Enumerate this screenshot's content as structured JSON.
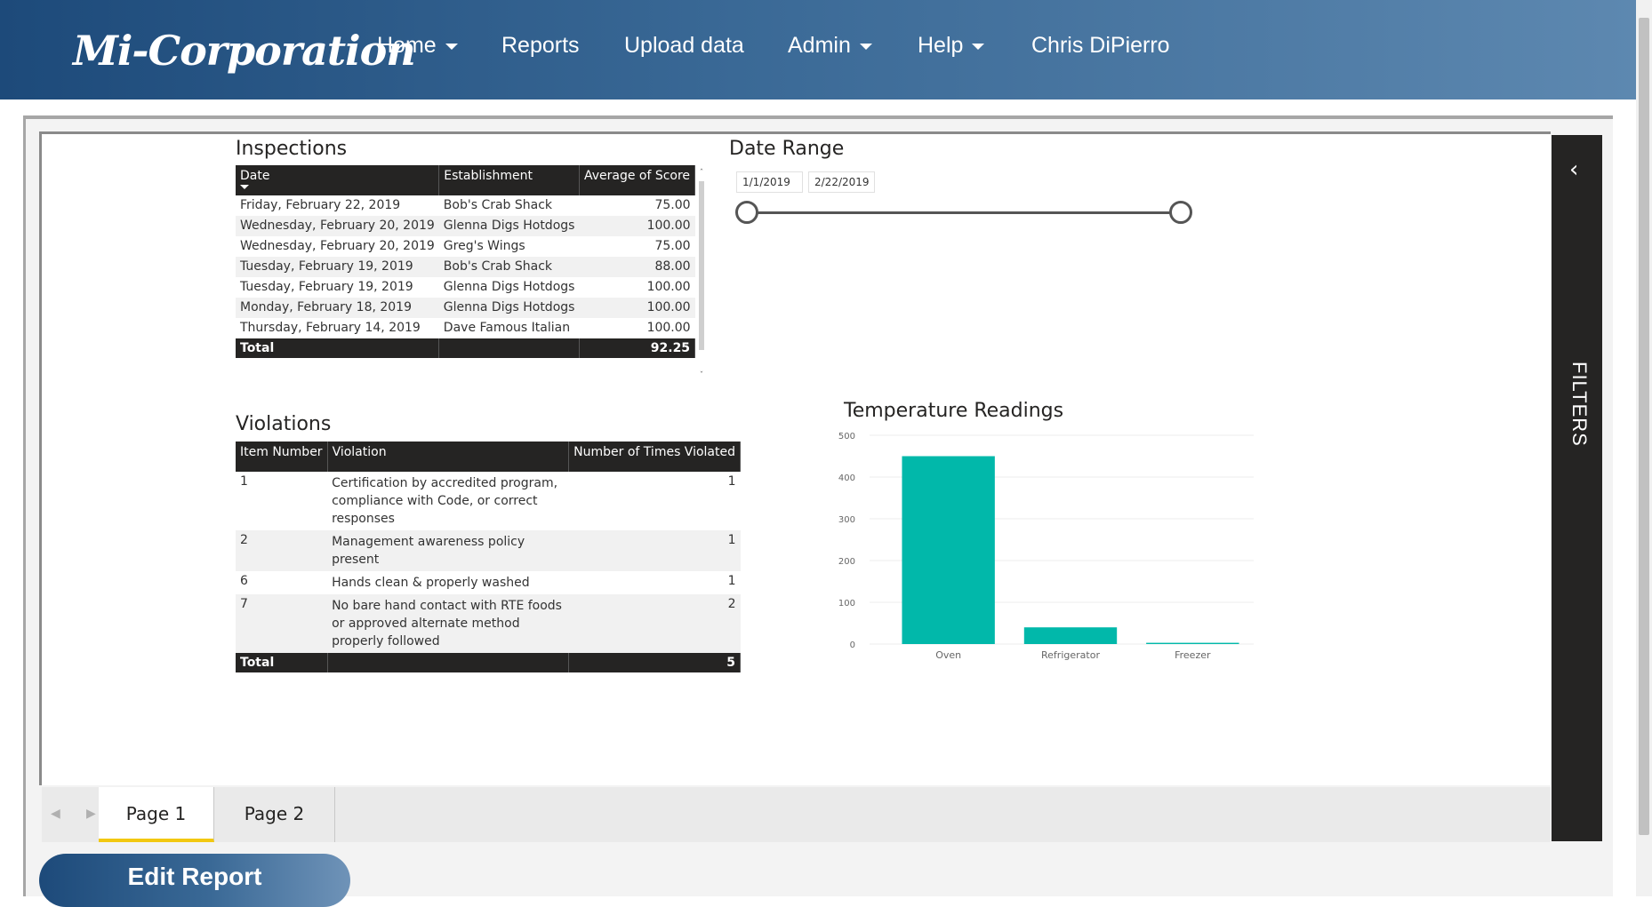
{
  "nav": {
    "logo": "Mi-Corporation",
    "items": [
      {
        "label": "Home",
        "dropdown": true
      },
      {
        "label": "Reports",
        "dropdown": false
      },
      {
        "label": "Upload data",
        "dropdown": false
      },
      {
        "label": "Admin",
        "dropdown": true
      },
      {
        "label": "Help",
        "dropdown": true
      },
      {
        "label": "Chris DiPierro",
        "dropdown": false
      }
    ]
  },
  "inspections": {
    "title": "Inspections",
    "headers": [
      "Date",
      "Establishment",
      "Average of Score"
    ],
    "rows": [
      [
        "Friday, February 22, 2019",
        "Bob's Crab Shack",
        "75.00"
      ],
      [
        "Wednesday, February 20, 2019",
        "Glenna Digs Hotdogs",
        "100.00"
      ],
      [
        "Wednesday, February 20, 2019",
        "Greg's Wings",
        "75.00"
      ],
      [
        "Tuesday, February 19, 2019",
        "Bob's Crab Shack",
        "88.00"
      ],
      [
        "Tuesday, February 19, 2019",
        "Glenna Digs Hotdogs",
        "100.00"
      ],
      [
        "Monday, February 18, 2019",
        "Glenna Digs Hotdogs",
        "100.00"
      ],
      [
        "Thursday, February 14, 2019",
        "Dave Famous Italian",
        "100.00"
      ]
    ],
    "total_label": "Total",
    "total_value": "92.25"
  },
  "date_range": {
    "title": "Date Range",
    "start": "1/1/2019",
    "end": "2/22/2019"
  },
  "violations": {
    "title": "Violations",
    "headers": [
      "Item Number",
      "Violation",
      "Number of Times Violated"
    ],
    "rows": [
      [
        "1",
        "Certification by accredited program, compliance with Code, or correct responses",
        "1"
      ],
      [
        "2",
        "Management awareness policy present",
        "1"
      ],
      [
        "6",
        "Hands clean & properly washed",
        "1"
      ],
      [
        "7",
        "No bare hand contact with RTE foods or approved alternate method properly followed",
        "2"
      ]
    ],
    "total_label": "Total",
    "total_value": "5"
  },
  "chart_data": {
    "type": "bar",
    "title": "Temperature Readings",
    "categories": [
      "Oven",
      "Refrigerator",
      "Freezer"
    ],
    "values": [
      450,
      40,
      3
    ],
    "ylim": [
      0,
      500
    ],
    "yticks": [
      "0",
      "100",
      "200",
      "300",
      "400",
      "500"
    ],
    "color": "#01b8aa",
    "grid": true
  },
  "filters": {
    "label": "FILTERS",
    "collapse_icon": "chevron-left-icon"
  },
  "pages": {
    "tabs": [
      "Page 1",
      "Page 2"
    ],
    "active": "Page 1"
  },
  "edit_report_label": "Edit Report",
  "colors": {
    "header_dark": "#252423",
    "accent_tab": "#f2c811",
    "bar": "#01b8aa",
    "nav_blue": "#1d4a7a"
  }
}
